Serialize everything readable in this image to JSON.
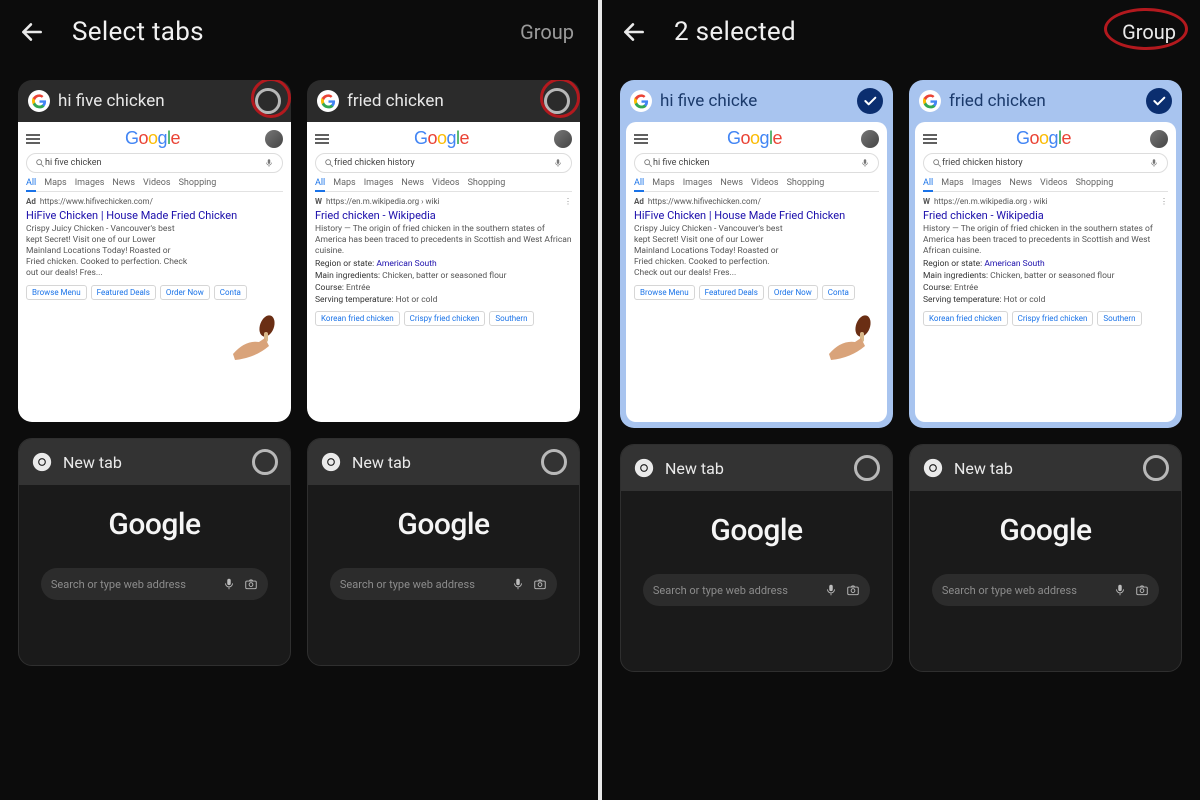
{
  "left": {
    "title": "Select tabs",
    "group_label": "Group",
    "tabs": [
      {
        "title": "hi five chicken",
        "search_query": "hi five chicken",
        "ad_label": "Ad",
        "ad_url": "https://www.hifivechicken.com/",
        "result_title": "HiFive Chicken | House Made Fried Chicken",
        "result_desc": "Crispy Juicy Chicken - Vancouver's best kept Secret! Visit one of our Lower Mainland Locations Today! Roasted or Fried chicken. Cooked to perfection. Check out our deals! Fres...",
        "chips": [
          "Browse Menu",
          "Featured Deals",
          "Order Now",
          "Conta"
        ]
      },
      {
        "title": "fried chicken",
        "search_query": "fried chicken history",
        "source_label": "W",
        "source_url": "https://en.m.wikipedia.org › wiki",
        "result_title": "Fried chicken - Wikipedia",
        "result_desc": "History — The origin of fried chicken in the southern states of America has been traced to precedents in Scottish and West African cuisine.",
        "facts": [
          {
            "label": "Region or state:",
            "link": "American South"
          },
          {
            "label": "Main ingredients:",
            "value": "Chicken, batter or seasoned flour"
          },
          {
            "label": "Course:",
            "value": "Entrée"
          },
          {
            "label": "Serving temperature:",
            "value": "Hot or cold"
          }
        ],
        "chips": [
          "Korean fried chicken",
          "Crispy fried chicken",
          "Southern"
        ]
      }
    ],
    "search_tabs": [
      "All",
      "Maps",
      "Images",
      "News",
      "Videos",
      "Shopping"
    ],
    "new_tab_label": "New tab",
    "omnibox_placeholder": "Search or type web address",
    "google_word": "Google"
  },
  "right": {
    "title": "2 selected",
    "group_label": "Group",
    "tabs": [
      {
        "title": "hi five chicke",
        "search_query": "hi five chicken",
        "ad_label": "Ad",
        "ad_url": "https://www.hifivechicken.com/",
        "result_title": "HiFive Chicken | House Made Fried Chicken",
        "result_desc": "Crispy Juicy Chicken - Vancouver's best kept Secret! Visit one of our Lower Mainland Locations Today! Roasted or Fried chicken. Cooked to perfection. Check out our deals! Fres...",
        "chips": [
          "Browse Menu",
          "Featured Deals",
          "Order Now",
          "Conta"
        ]
      },
      {
        "title": "fried chicken",
        "search_query": "fried chicken history",
        "source_label": "W",
        "source_url": "https://en.m.wikipedia.org › wiki",
        "result_title": "Fried chicken - Wikipedia",
        "result_desc": "History — The origin of fried chicken in the southern states of America has been traced to precedents in Scottish and West African cuisine.",
        "facts": [
          {
            "label": "Region or state:",
            "link": "American South"
          },
          {
            "label": "Main ingredients:",
            "value": "Chicken, batter or seasoned flour"
          },
          {
            "label": "Course:",
            "value": "Entrée"
          },
          {
            "label": "Serving temperature:",
            "value": "Hot or cold"
          }
        ],
        "chips": [
          "Korean fried chicken",
          "Crispy fried chicken",
          "Southern"
        ]
      }
    ],
    "search_tabs": [
      "All",
      "Maps",
      "Images",
      "News",
      "Videos",
      "Shopping"
    ],
    "new_tab_label": "New tab",
    "omnibox_placeholder": "Search or type web address",
    "google_word": "Google"
  },
  "icons": {
    "back": "arrow-left",
    "search": "magnifier",
    "mic": "microphone",
    "camera": "camera"
  },
  "colors": {
    "annotation": "#b3191e",
    "selected_bg": "#a8c4ef",
    "check_bg": "#0b2e6f"
  }
}
